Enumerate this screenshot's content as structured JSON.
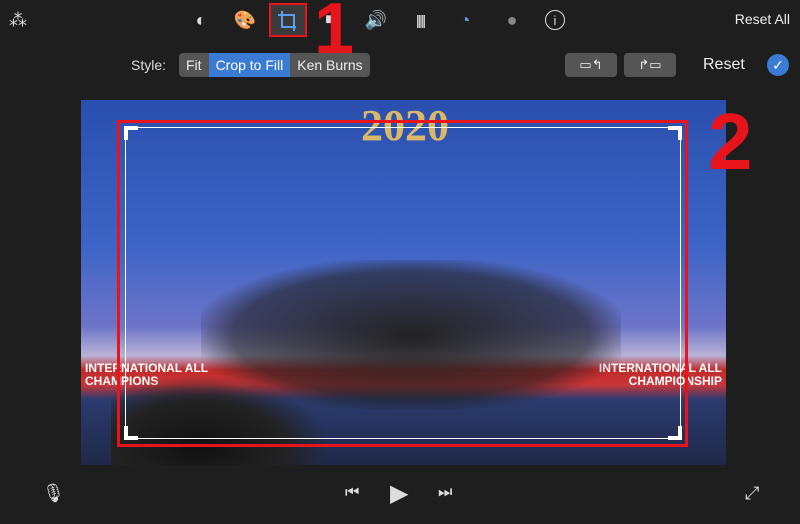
{
  "toolbar": {
    "reset_all": "Reset All",
    "icons": [
      "magic-wand-icon",
      "color-balance-icon",
      "color-palette-icon",
      "crop-icon",
      "camera-stabilization-icon",
      "volume-icon",
      "equalizer-icon",
      "speed-icon",
      "filter-icon",
      "info-icon"
    ]
  },
  "style_bar": {
    "label": "Style:",
    "options": [
      "Fit",
      "Crop to Fill",
      "Ken Burns"
    ],
    "selected": "Crop to Fill",
    "reset": "Reset"
  },
  "video": {
    "year_text": "2020",
    "banner_left": "INTERNATIONAL ALL",
    "banner_left2": "CHAMPIONS",
    "banner_right": "INTERNATIONAL ALL",
    "banner_right2": "CHAMPIONSHIP"
  },
  "annotations": {
    "one": "1",
    "two": "2"
  },
  "colors": {
    "accent": "#3a7bd5",
    "annotation": "#e8141b"
  }
}
